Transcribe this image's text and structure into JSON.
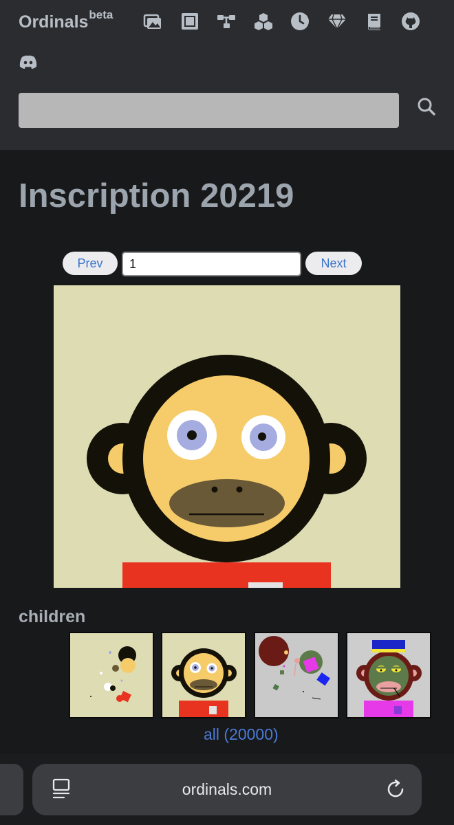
{
  "header": {
    "brand": "Ordinals",
    "brand_sup": "beta",
    "nav_icons": [
      "gallery-icon",
      "square-icon",
      "network-icon",
      "blocks-icon",
      "clock-icon",
      "diamond-icon",
      "book-icon",
      "github-icon",
      "discord-icon"
    ],
    "search": {
      "value": "",
      "placeholder": ""
    }
  },
  "page": {
    "title": "Inscription 20219"
  },
  "pager": {
    "prev_label": "Prev",
    "page_value": "1",
    "next_label": "Next"
  },
  "children": {
    "label": "children",
    "all_link": "all (20000)"
  },
  "browser": {
    "url": "ordinals.com"
  },
  "colors": {
    "header_bg": "#2b2c2f",
    "page_bg": "#18191b",
    "link": "#4b7ad6",
    "preview_bg": "#dedcb3"
  }
}
